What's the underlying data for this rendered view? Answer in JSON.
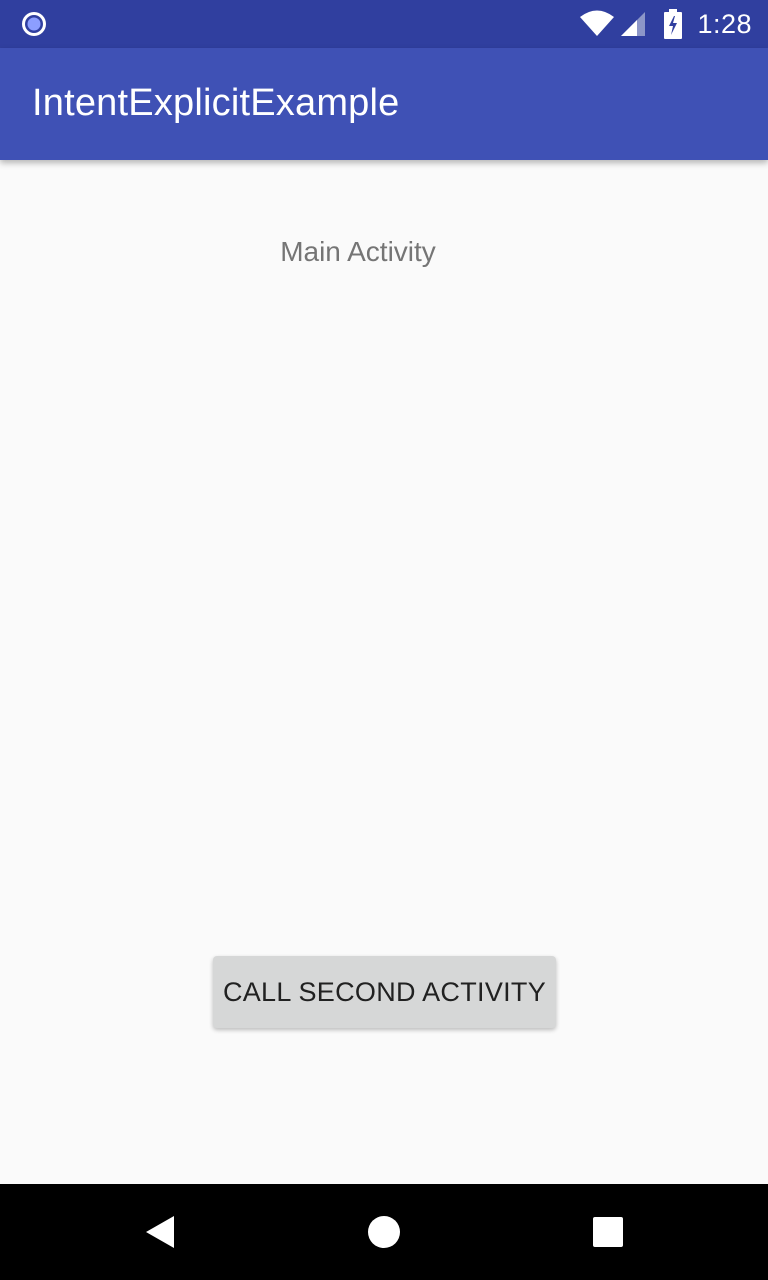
{
  "status_bar": {
    "time": "1:28",
    "background_color": "#303f9f",
    "icons": [
      "notification-dot-icon",
      "wifi-icon",
      "cell-signal-icon",
      "battery-charging-icon"
    ]
  },
  "app_bar": {
    "title": "IntentExplicitExample",
    "background_color": "#3f51b5"
  },
  "main": {
    "label": "Main Activity",
    "call_button_label": "CALL SECOND ACTIVITY"
  },
  "nav_bar": {
    "icons": [
      "back-icon",
      "home-icon",
      "recents-icon"
    ]
  }
}
